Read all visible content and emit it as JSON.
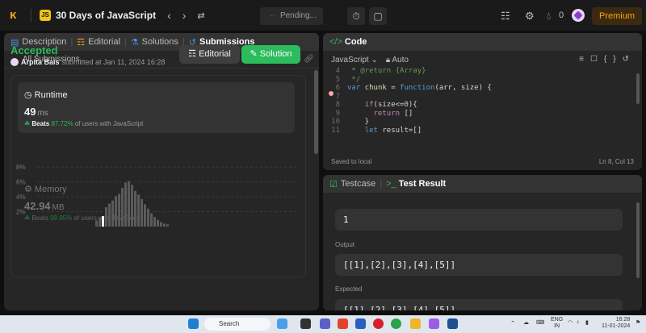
{
  "topbar": {
    "study_title": "30 Days of JavaScript",
    "study_badge": "JS",
    "pending_label": "Pending...",
    "points": "0",
    "premium_label": "Premium"
  },
  "left_tabs": [
    "Description",
    "Editorial",
    "Solutions",
    "Submissions"
  ],
  "all_submissions": "All Submissions",
  "result": {
    "status": "Accepted",
    "user": "Arpita Bais",
    "submitted_at": "submitted at Jan 11, 2024 16:28",
    "editorial_btn": "Editorial",
    "solution_btn": "Solution"
  },
  "runtime": {
    "title": "Runtime",
    "value": "49",
    "unit": "ms",
    "beats": "Beats",
    "beats_pct": "87.72%",
    "beats_suffix": "of users with JavaScript"
  },
  "memory": {
    "title": "Memory",
    "value": "42.94",
    "unit": "MB",
    "beats": "Beats",
    "beats_pct": "99.95%",
    "beats_suffix": "of users with JavaScript"
  },
  "chart_data": {
    "type": "bar",
    "y_ticks": [
      "8%",
      "6%",
      "4%",
      "2%"
    ],
    "values": [
      0.8,
      1.2,
      1.4,
      2.6,
      3.1,
      3.5,
      4.1,
      4.4,
      5.2,
      5.9,
      6.1,
      5.6,
      4.8,
      4.3,
      3.7,
      3.0,
      2.4,
      1.8,
      1.3,
      0.9,
      0.6,
      0.4,
      0.3
    ],
    "highlight_index": 2,
    "ylim": [
      0,
      9
    ]
  },
  "code_panel": {
    "title": "Code",
    "language": "JavaScript",
    "mode": "Auto",
    "lines": [
      {
        "n": "4",
        "text": " * @return {Array}"
      },
      {
        "n": "5",
        "text": " */"
      },
      {
        "n": "6",
        "text": "var chunk = function(arr, size) {"
      },
      {
        "n": "7",
        "text": ""
      },
      {
        "n": "8",
        "text": "    if(size<=0){"
      },
      {
        "n": "9",
        "text": "      return []"
      },
      {
        "n": "10",
        "text": "    }"
      },
      {
        "n": "11",
        "text": "    let result=[]"
      }
    ],
    "saved": "Saved to local",
    "cursor": "Ln 8, Col 13"
  },
  "test_panel": {
    "tabs": [
      "Testcase",
      "Test Result"
    ],
    "input_value": "1",
    "output_label": "Output",
    "output_value": "[[1],[2],[3],[4],[5]]",
    "expected_label": "Expected",
    "expected_value": "[[1],[2],[3],[4],[5]]"
  },
  "taskbar": {
    "search": "Search",
    "lang": "ENG",
    "region": "IN",
    "time": "16:28",
    "date": "11-01-2024"
  }
}
